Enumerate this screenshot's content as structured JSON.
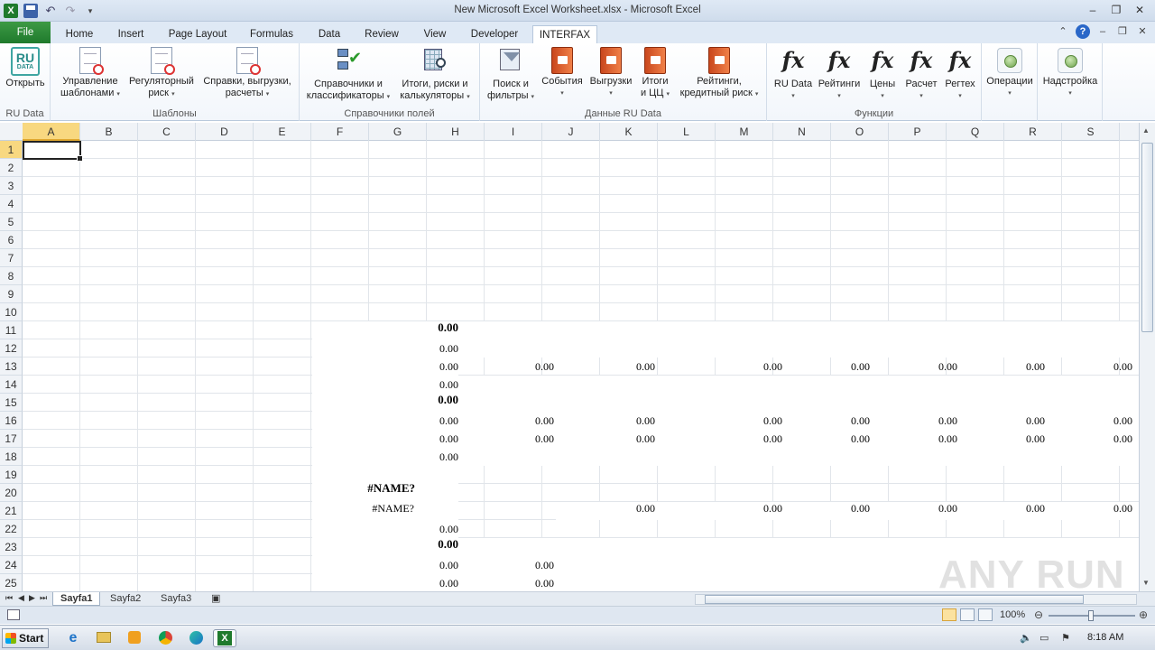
{
  "window": {
    "title": "New Microsoft Excel Worksheet.xlsx - Microsoft Excel"
  },
  "tabs": [
    {
      "label": "File"
    },
    {
      "label": "Home"
    },
    {
      "label": "Insert"
    },
    {
      "label": "Page Layout"
    },
    {
      "label": "Formulas"
    },
    {
      "label": "Data"
    },
    {
      "label": "Review"
    },
    {
      "label": "View"
    },
    {
      "label": "Developer"
    },
    {
      "label": "INTERFAX"
    }
  ],
  "ribbon": {
    "groups": {
      "rudata": "RU Data",
      "templates": "Шаблоны",
      "fieldrefs": "Справочники полей",
      "rudata2": "Данные RU Data",
      "functions": "Функции"
    },
    "buttons": {
      "open": "Открыть",
      "tmpl_mgmt": [
        "Управление",
        "шаблонами"
      ],
      "regrisk": [
        "Регуляторный",
        "риск"
      ],
      "refs": [
        "Справки, выгрузки,",
        "расчеты"
      ],
      "classif": [
        "Справочники и",
        "классификаторы"
      ],
      "totals": [
        "Итоги, риски и",
        "калькуляторы"
      ],
      "search": [
        "Поиск и",
        "фильтры"
      ],
      "events": "События",
      "exports": "Выгрузки",
      "totals2": [
        "Итоги",
        "и ЦЦ"
      ],
      "ratings": [
        "Рейтинги,",
        "кредитный риск"
      ],
      "fx_rudata": "RU Data",
      "fx_ratings": "Рейтинги",
      "fx_prices": "Цены",
      "fx_calc": "Расчет",
      "fx_regtech": "Регтех",
      "ops": "Операции",
      "addin": "Надстройка"
    },
    "rubox": {
      "top": "RU",
      "sub": "DATA"
    }
  },
  "columns": [
    "A",
    "B",
    "C",
    "D",
    "E",
    "F",
    "G",
    "H",
    "I",
    "J",
    "K",
    "L",
    "M",
    "N",
    "O",
    "P",
    "Q",
    "R",
    "S"
  ],
  "rows": [
    "1",
    "2",
    "3",
    "4",
    "5",
    "6",
    "7",
    "8",
    "9",
    "10",
    "11",
    "12",
    "13",
    "14",
    "15",
    "16",
    "17",
    "18",
    "19",
    "20",
    "21",
    "22",
    "23",
    "24",
    "25"
  ],
  "cells": [
    {
      "text": "0.00",
      "bold": true
    },
    {
      "text": "0.00"
    },
    {
      "text": "0.00"
    },
    {
      "text": "0.00"
    },
    {
      "text": "0.00"
    },
    {
      "text": "0.00"
    },
    {
      "text": "0.00"
    },
    {
      "text": "0.00"
    },
    {
      "text": "0.00"
    },
    {
      "text": "0.00"
    },
    {
      "text": "0.00"
    },
    {
      "text": "0.00",
      "bold": true
    },
    {
      "text": "0.00"
    },
    {
      "text": "0.00"
    },
    {
      "text": "0.00"
    },
    {
      "text": "0.00"
    },
    {
      "text": "0.00"
    },
    {
      "text": "0.00"
    },
    {
      "text": "0.00"
    },
    {
      "text": "0.00"
    },
    {
      "text": "0.00"
    },
    {
      "text": "0.00"
    },
    {
      "text": "0.00"
    },
    {
      "text": "0.00"
    },
    {
      "text": "0.00"
    },
    {
      "text": "0.00"
    },
    {
      "text": "0.00"
    },
    {
      "text": "0.00"
    },
    {
      "text": "0.00"
    },
    {
      "text": "#NAME?",
      "bold": true
    },
    {
      "text": "#NAME?"
    },
    {
      "text": "0.00"
    },
    {
      "text": "0.00"
    },
    {
      "text": "0.00"
    },
    {
      "text": "0.00"
    },
    {
      "text": "0.00"
    },
    {
      "text": "0.00"
    },
    {
      "text": "0.00"
    },
    {
      "text": "0.00",
      "bold": true
    },
    {
      "text": "0.00"
    },
    {
      "text": "0.00"
    },
    {
      "text": "0.00"
    },
    {
      "text": "0.00"
    }
  ],
  "sheets": [
    {
      "label": "Sayfa1"
    },
    {
      "label": "Sayfa2"
    },
    {
      "label": "Sayfa3"
    }
  ],
  "status": {
    "zoom": "100%"
  },
  "taskbar": {
    "start": "Start",
    "clock": "8:18 AM"
  },
  "watermark": "ANY RUN",
  "colors": {
    "file_tab": "#1f7a2c",
    "selection_header": "#f8d880"
  }
}
